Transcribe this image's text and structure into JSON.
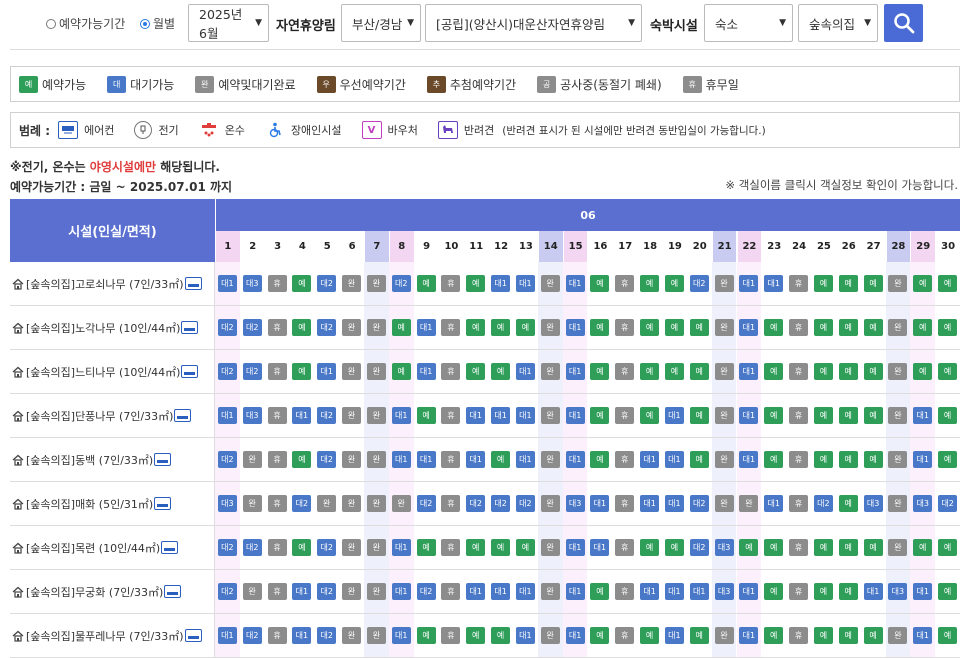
{
  "search": {
    "radio_period_label": "예약가능기간",
    "radio_month_label": "월별",
    "month_value": "2025년 6월",
    "forest_label": "자연휴양림",
    "region_value": "부산/경남",
    "forest_value": "[공립](양산시)대운산자연휴양림",
    "lodging_label": "숙박시설",
    "lodging_type_value": "숙소",
    "lodging_sub_value": "숲속의집"
  },
  "status_legend": [
    {
      "code": "예",
      "label": "예약가능",
      "color": "#2e9e58"
    },
    {
      "code": "대",
      "label": "대기가능",
      "color": "#4a78c8"
    },
    {
      "code": "완",
      "label": "예약및대기완료",
      "color": "#8c8c8c"
    },
    {
      "code": "우",
      "label": "우선예약기간",
      "color": "#6b4a2a"
    },
    {
      "code": "추",
      "label": "추첨예약기간",
      "color": "#6b4a2a"
    },
    {
      "code": "공",
      "label": "공사중(동절기 폐쇄)",
      "color": "#8c8c8c"
    },
    {
      "code": "휴",
      "label": "휴무일",
      "color": "#8c8c8c"
    }
  ],
  "facility_legend": {
    "title": "범례 :",
    "items": [
      {
        "icon": "aircon-icon",
        "label": "에어컨"
      },
      {
        "icon": "electric-icon",
        "label": "전기"
      },
      {
        "icon": "hot-water-icon",
        "label": "온수"
      },
      {
        "icon": "accessibility-icon",
        "label": "장애인시설"
      },
      {
        "icon": "voucher-icon",
        "label": "바우처"
      },
      {
        "icon": "pet-icon",
        "label": "반려견"
      }
    ],
    "pet_note": "(반려견 표시가 된 시설에만 반려견 동반입실이 가능합니다.)"
  },
  "notes": {
    "line1_a": "※전기, 온수는 ",
    "line1_red": "야영시설에만",
    "line1_b": " 해당됩니다.",
    "line2": "예약가능기간 : 금일 ~ 2025.07.01 까지",
    "line3": "※ 객실이름 클릭시 객실정보 확인이 가능합니다."
  },
  "table": {
    "facility_header": "시설(인실/면적)",
    "month_header": "06",
    "days": [
      "1",
      "2",
      "3",
      "4",
      "5",
      "6",
      "7",
      "8",
      "9",
      "10",
      "11",
      "12",
      "13",
      "14",
      "15",
      "16",
      "17",
      "18",
      "19",
      "20",
      "21",
      "22",
      "23",
      "24",
      "25",
      "26",
      "27",
      "28",
      "29",
      "30"
    ],
    "day_types": [
      "sun",
      "",
      "",
      "",
      "",
      "",
      "sat",
      "sun",
      "",
      "",
      "",
      "",
      "",
      "sat",
      "sun",
      "",
      "",
      "",
      "",
      "",
      "sat",
      "sun",
      "",
      "",
      "",
      "",
      "",
      "sat",
      "sun",
      ""
    ],
    "status_colors": {
      "예": "#2e9e58",
      "대1": "#4a78c8",
      "대2": "#4a78c8",
      "대3": "#4a78c8",
      "완": "#8c8c8c",
      "휴": "#8c8c8c"
    },
    "rows": [
      {
        "name": "[숲속의집]고로쇠나무 (7인/33㎡)",
        "cells": [
          "대1",
          "대3",
          "휴",
          "예",
          "대2",
          "완",
          "완",
          "대2",
          "예",
          "휴",
          "예",
          "대1",
          "대1",
          "완",
          "대1",
          "예",
          "휴",
          "예",
          "예",
          "대2",
          "완",
          "대1",
          "대1",
          "휴",
          "예",
          "예",
          "예",
          "완",
          "예",
          "예"
        ]
      },
      {
        "name": "[숲속의집]노각나무 (10인/44㎡)",
        "cells": [
          "대2",
          "대2",
          "휴",
          "예",
          "대2",
          "완",
          "완",
          "예",
          "대1",
          "휴",
          "예",
          "예",
          "예",
          "완",
          "대1",
          "예",
          "휴",
          "예",
          "예",
          "예",
          "완",
          "대1",
          "예",
          "휴",
          "예",
          "예",
          "예",
          "완",
          "예",
          "예"
        ]
      },
      {
        "name": "[숲속의집]느티나무 (10인/44㎡)",
        "cells": [
          "대2",
          "대2",
          "휴",
          "예",
          "대1",
          "완",
          "완",
          "예",
          "대1",
          "휴",
          "예",
          "예",
          "대1",
          "완",
          "대1",
          "예",
          "휴",
          "예",
          "예",
          "예",
          "완",
          "대1",
          "예",
          "휴",
          "예",
          "예",
          "예",
          "완",
          "예",
          "예"
        ]
      },
      {
        "name": "[숲속의집]단풍나무 (7인/33㎡)",
        "cells": [
          "대1",
          "대3",
          "휴",
          "대1",
          "대2",
          "완",
          "완",
          "대1",
          "예",
          "휴",
          "대1",
          "대1",
          "대1",
          "완",
          "대1",
          "예",
          "휴",
          "예",
          "대1",
          "예",
          "완",
          "대1",
          "예",
          "휴",
          "예",
          "예",
          "예",
          "완",
          "대1",
          "예"
        ]
      },
      {
        "name": "[숲속의집]동백 (7인/33㎡)",
        "cells": [
          "대2",
          "완",
          "휴",
          "예",
          "대2",
          "완",
          "완",
          "대1",
          "대1",
          "휴",
          "대1",
          "예",
          "대1",
          "완",
          "대1",
          "예",
          "휴",
          "대1",
          "대1",
          "예",
          "완",
          "대1",
          "예",
          "휴",
          "예",
          "예",
          "예",
          "완",
          "대1",
          "예"
        ]
      },
      {
        "name": "[숲속의집]매화 (5인/31㎡)",
        "cells": [
          "대3",
          "완",
          "휴",
          "대2",
          "완",
          "완",
          "완",
          "완",
          "대2",
          "휴",
          "대2",
          "대2",
          "대2",
          "완",
          "대3",
          "대1",
          "휴",
          "대1",
          "대1",
          "대2",
          "완",
          "완",
          "대1",
          "휴",
          "대2",
          "예",
          "대3",
          "완",
          "대3",
          "대2"
        ]
      },
      {
        "name": "[숲속의집]목련 (10인/44㎡)",
        "cells": [
          "대2",
          "대2",
          "휴",
          "예",
          "대2",
          "완",
          "완",
          "대1",
          "예",
          "휴",
          "예",
          "예",
          "예",
          "완",
          "대1",
          "대1",
          "휴",
          "예",
          "예",
          "대2",
          "대3",
          "예",
          "예",
          "휴",
          "예",
          "예",
          "예",
          "완",
          "예",
          "예"
        ]
      },
      {
        "name": "[숲속의집]무궁화 (7인/33㎡)",
        "cells": [
          "대2",
          "완",
          "휴",
          "대1",
          "대2",
          "완",
          "완",
          "대1",
          "대2",
          "휴",
          "대1",
          "대1",
          "대1",
          "완",
          "대1",
          "예",
          "휴",
          "대1",
          "대1",
          "대1",
          "대3",
          "대1",
          "예",
          "휴",
          "예",
          "예",
          "대1",
          "대3",
          "대1",
          "예"
        ]
      },
      {
        "name": "[숲속의집]물푸레나무 (7인/33㎡)",
        "cells": [
          "대1",
          "대2",
          "휴",
          "대1",
          "대2",
          "완",
          "완",
          "대1",
          "예",
          "휴",
          "예",
          "예",
          "대1",
          "완",
          "대1",
          "예",
          "휴",
          "예",
          "대1",
          "예",
          "완",
          "대1",
          "예",
          "휴",
          "예",
          "예",
          "예",
          "완",
          "대1",
          "예"
        ]
      }
    ]
  }
}
